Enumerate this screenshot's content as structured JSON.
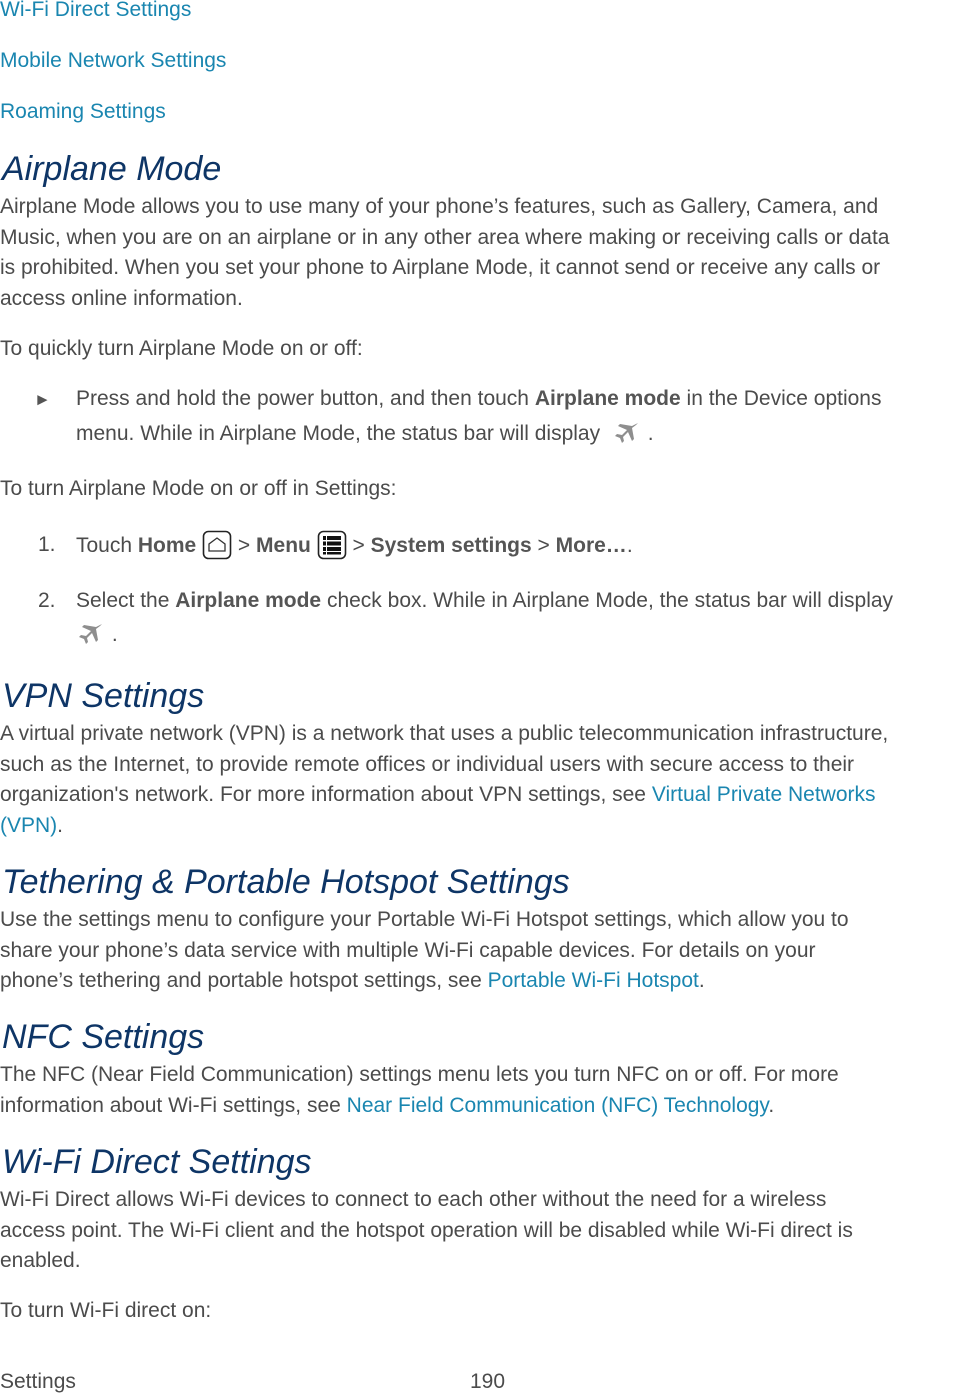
{
  "toc_links": [
    "Wi-Fi Direct Settings",
    "Mobile Network Settings",
    "Roaming Settings"
  ],
  "colors": {
    "heading": "#0e3566",
    "link": "#1a86b0",
    "body_text": "#4b4b4b"
  },
  "airplane": {
    "heading": "Airplane Mode",
    "intro": [
      "Airplane Mode allows you to use many of your phone’s features, such as Gallery, Camera, and",
      "Music, when you are on an airplane or in any other area where making or receiving calls or data",
      "is prohibited. When you set your phone to Airplane Mode, it cannot send or receive any calls or",
      "access online information."
    ],
    "quick_label": "To quickly turn Airplane Mode on or off:",
    "bullet_marker": "►",
    "bullet": {
      "pre": "Press and hold the power button, and then touch ",
      "bold": "Airplane mode",
      "post": " in the Device options",
      "line2": "menu. While in Airplane Mode, the status bar will display",
      "end": " .",
      "icon": "airplane-icon"
    },
    "settings_label": "To turn Airplane Mode on or off in Settings:",
    "steps": [
      {
        "num": "1.",
        "touch": "Touch ",
        "home": "Home",
        "sep": " > ",
        "menu": "Menu",
        "system": "System settings",
        "more": "More…",
        "end": ".",
        "icons": [
          "home-icon",
          "menu-icon"
        ]
      },
      {
        "num": "2.",
        "pre": "Select the ",
        "bold": "Airplane mode",
        "post": " check box. While in Airplane Mode, the status bar will display",
        "end": " .",
        "icon": "airplane-icon"
      }
    ]
  },
  "vpn": {
    "heading": "VPN Settings",
    "lines": [
      "A virtual private network (VPN) is a network that uses a public telecommunication infrastructure,",
      "such as the Internet, to provide remote offices or individual users with secure access to their",
      "organization's network. For more information about VPN settings, see "
    ],
    "link1": "Virtual Private Networks",
    "link2": "(VPN)",
    "end": "."
  },
  "tethering": {
    "heading": "Tethering & Portable Hotspot Settings",
    "lines": [
      "Use the settings menu to configure your Portable Wi-Fi Hotspot settings, which allow you to",
      "share your phone’s data service with multiple Wi-Fi capable devices. For details on your",
      "phone’s tethering and portable hotspot settings, see "
    ],
    "link": "Portable Wi-Fi Hotspot",
    "end": "."
  },
  "nfc": {
    "heading": "NFC Settings",
    "lines": [
      "The NFC (Near Field Communication) settings menu lets you turn NFC on or off. For more",
      "information about Wi-Fi settings, see "
    ],
    "link": "Near Field Communication (NFC) Technology",
    "end": "."
  },
  "wifi_direct": {
    "heading": "Wi-Fi Direct Settings",
    "lines": [
      "Wi-Fi Direct allows Wi-Fi devices to connect to each other without the need for a wireless",
      "access point. The Wi-Fi client and the hotspot operation will be disabled while Wi-Fi direct is",
      "enabled."
    ],
    "turn_on_label": "To turn Wi-Fi direct on:"
  },
  "footer": {
    "section": "Settings",
    "page": "190"
  }
}
